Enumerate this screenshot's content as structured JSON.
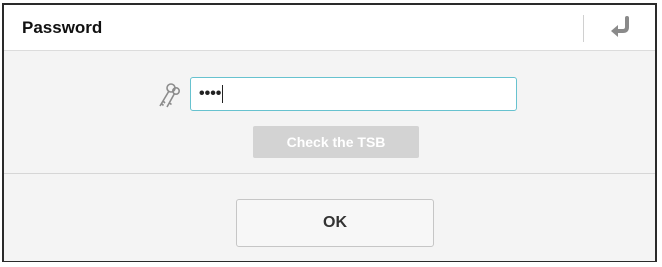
{
  "dialog": {
    "title": "Password",
    "back_icon": "return-arrow-icon"
  },
  "form": {
    "key_icon": "keys-icon",
    "password_value": "••••",
    "check_button_label": "Check the TSB"
  },
  "footer": {
    "ok_label": "OK"
  },
  "colors": {
    "input_border": "#67c2cf",
    "check_button_bg": "#d3d3d3",
    "body_bg": "#f4f4f4"
  }
}
